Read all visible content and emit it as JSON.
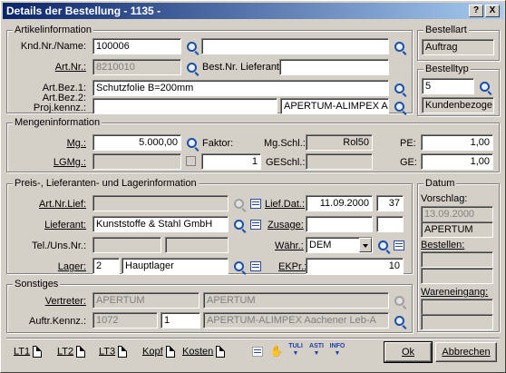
{
  "window": {
    "title": "Details der Bestellung - 1135 -",
    "help": "?",
    "close": "X"
  },
  "artikel": {
    "group": "Artikelinformation",
    "knd_label": "Knd.Nr./Name:",
    "knd_value": "100006",
    "knd_name": "",
    "artnr_label": "Art.Nr.:",
    "artnr_value": "8210010",
    "bestnr_label": "Best.Nr. Lieferant:",
    "bestnr_value": "",
    "bez1_label": "Art.Bez.1:",
    "bez1_value": "Schutzfolie B=200mm",
    "bez2_label": "Art.Bez.2:",
    "proj_label": "Proj.kennz.:",
    "bez2_value": "",
    "proj_value": "APERTUM-ALIMPEX Aac"
  },
  "bestellart": {
    "group": "Bestellart",
    "value": "Auftrag"
  },
  "bestelltyp": {
    "group": "Bestelltyp",
    "code": "5",
    "value": "Kundenbezoge"
  },
  "menge": {
    "group": "Mengeninformation",
    "mg_label": "Mg.:",
    "mg_value": "5.000,00",
    "faktor_label": "Faktor:",
    "mgschl_label": "Mg.Schl.:",
    "mgschl_value": "Rol50",
    "pe_label": "PE:",
    "pe_value": "1,00",
    "lgmg_label": "LGMg.:",
    "faktor_value": "1",
    "geschl_label": "GESchl.:",
    "geschl_value": "",
    "ge_label": "GE:",
    "ge_value": "1,00"
  },
  "preis": {
    "group": "Preis-, Lieferanten- und Lagerinformation",
    "artnrlief_label": "Art.Nr.Lief:",
    "artnrlief_value": "",
    "liefdat_label": "Lief.Dat.:",
    "liefdat_value": "11.09.2000",
    "week": "37",
    "lieferant_label": "Lieferant:",
    "lieferant_value": "Kunststoffe & Stahl GmbH",
    "zusage_label": "Zusage:",
    "tel_label": "Tel./Uns.Nr.:",
    "waehr_label": "Währ.:",
    "waehr_value": "DEM",
    "lager_label": "Lager:",
    "lager_code": "2",
    "lager_value": "Hauptlager",
    "ekpr_label": "EKPr.:",
    "ekpr_value": "10"
  },
  "datum": {
    "group": "Datum",
    "vorschlag_label": "Vorschlag:",
    "vorschlag_date": "13.09.2000",
    "vorschlag_user": "APERTUM",
    "bestellen_label": "Bestellen:",
    "wareneingang_label": "Wareneingang:"
  },
  "sonstiges": {
    "group": "Sonstiges",
    "vertreter_label": "Vertreter:",
    "vertreter_value": "APERTUM",
    "vertreter_name": "APERTUM",
    "auftr_label": "Auftr.Kennz.:",
    "auftr_nr": "1072",
    "auftr_pos": "1",
    "auftr_name": "APERTUM-ALIMPEX Aachener Leb-A"
  },
  "footer": {
    "lt1": "LT1",
    "lt2": "LT2",
    "lt3": "LT3",
    "kopf": "Kopf",
    "kosten": "Kosten",
    "tool1": "TULI",
    "tool2": "ASTI",
    "tool3": "INFO",
    "ok": "Ok",
    "abbrechen": "Abbrechen"
  }
}
